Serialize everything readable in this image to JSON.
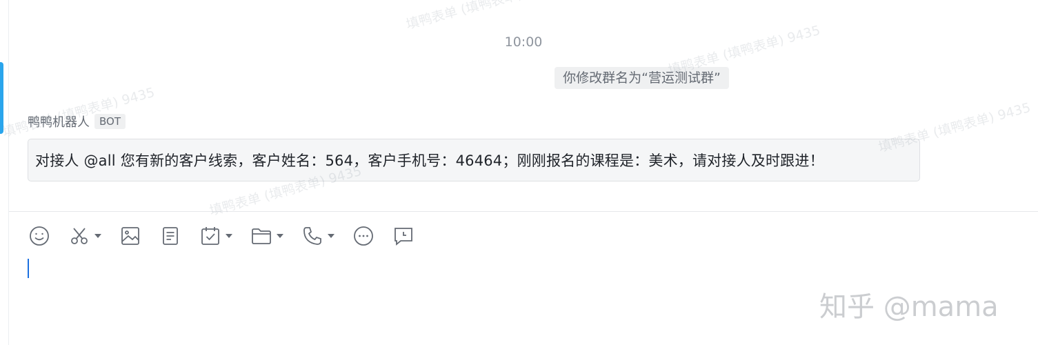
{
  "chat": {
    "timestamp": "10:00",
    "system_message": "你修改群名为“营运测试群”",
    "sender": {
      "name": "鸭鸭机器人",
      "badge": "BOT"
    },
    "message_text": "对接人 @all 您有新的客户线索，客户姓名：564，客户手机号：46464；刚刚报名的课程是：美术，请对接人及时跟进！"
  },
  "toolbar": {
    "icons": [
      "emoji-icon",
      "scissors-icon",
      "image-icon",
      "document-icon",
      "calendar-check-icon",
      "folder-icon",
      "phone-icon",
      "more-icon",
      "feedback-icon"
    ]
  },
  "watermarks": {
    "text": "填鸭表单 (填鸭表单) 9435"
  },
  "zhihu_watermark": "知乎 @mama",
  "colors": {
    "accent": "#2aa5ec",
    "bubble_bg": "#f5f6f7",
    "system_bg": "#eff0f1",
    "cursor": "#1b6fe0"
  }
}
